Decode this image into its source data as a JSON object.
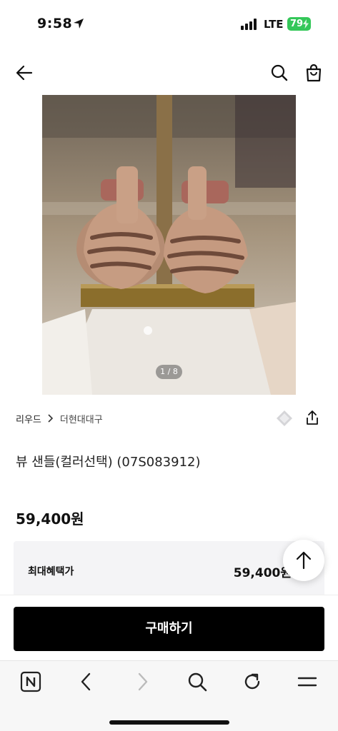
{
  "status_bar": {
    "time": "9:58",
    "network": "LTE",
    "battery": "79"
  },
  "header": {
    "back_icon": "arrow-left-icon",
    "search_icon": "search-icon",
    "bag_icon": "shopping-bag-icon"
  },
  "gallery": {
    "counter": "1 / 8"
  },
  "breadcrumb": {
    "brand": "리우드",
    "store": "더현대대구"
  },
  "product": {
    "title": "뷰 샌들(컬러선택) (07S083912)",
    "price": "59,400원"
  },
  "benefit": {
    "label": "최대혜택가",
    "value": "59,400원"
  },
  "buy": {
    "label": "구매하기"
  },
  "toolbar": {
    "icons": [
      "naver-n-icon",
      "back-icon",
      "forward-icon",
      "search-icon",
      "refresh-icon",
      "menu-icon"
    ]
  },
  "colors": {
    "battery": "#34c759",
    "buy_button": "#000000",
    "benefit_bg": "#f4f4f6"
  }
}
